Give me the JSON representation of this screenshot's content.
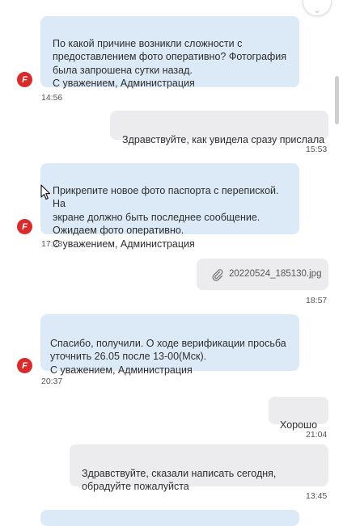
{
  "messages": [
    {
      "direction": "in",
      "text": "По какой причине возникли сложности с\nпредоставлением фото оперативно? Фотография\nбыла запрошена сутки назад.\nС уважением, Администрация",
      "time": "14:56"
    },
    {
      "direction": "out",
      "text": "Здравствуйте, как увидела сразу прислала",
      "time": "15:53"
    },
    {
      "direction": "in",
      "text": "Прикрепите новое фото паспорта с перепиской. На\nэкране должно быть последнее сообщение.\nОжидаем фото оперативно.\nС уважением, Администрация",
      "time": "17:28"
    },
    {
      "direction": "out",
      "attachment": "20220524_185130.jpg",
      "time": "18:57"
    },
    {
      "direction": "in",
      "text": " Спасибо, получили. О ходе верификации просьба\nуточнить 26.05 после 13-00(Мск).\nС уважением, Администрация",
      "time": "20:37"
    },
    {
      "direction": "out",
      "text": "Хорошо",
      "time": "21:04"
    },
    {
      "direction": "out",
      "text": "Здравствуйте, сказали написать сегодня,\nобрадуйте пожалуйста",
      "time": "13:45"
    }
  ],
  "avatar_letter": "F",
  "icons": {
    "avatar": "admin-logo-icon",
    "attachment": "paperclip-icon",
    "corner": "scroll-down-icon",
    "cursor": "mouse-pointer-icon"
  },
  "colors": {
    "incoming_bubble": "#dceaf8",
    "outgoing_bubble": "#ececef",
    "avatar": "#dc2a2a"
  }
}
